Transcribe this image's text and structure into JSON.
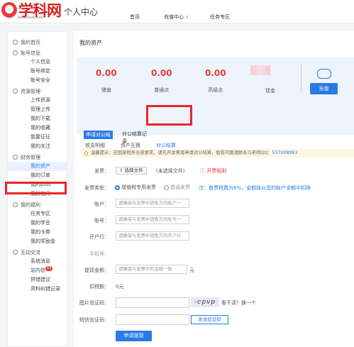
{
  "header": {
    "logo_text": "学科网",
    "logo_sub": "www.zxxk.com",
    "page_heading": "个人中心",
    "nav": [
      "首页",
      "充值中心",
      "任务专区"
    ],
    "nav_caret": "∨"
  },
  "sidebar": {
    "home": "我的首页",
    "groups": [
      {
        "title": "账号信息",
        "icon": "star-icon",
        "items": [
          "个人信息",
          "账号绑定",
          "账号安全"
        ]
      },
      {
        "title": "资源管理",
        "icon": "folder-icon",
        "items": [
          "上传资源",
          "管理上传",
          "我的下载",
          "我的收藏",
          "我要征征",
          "我的关注"
        ]
      },
      {
        "title": "财务管理",
        "icon": "wallet-icon",
        "items": [
          "我的资产",
          "我的订单",
          "我的plus",
          "我的包月"
        ]
      },
      {
        "title": "我的福利",
        "icon": "gift-icon",
        "items": [
          "任务专区",
          "我的学豆",
          "我的卡券",
          "我的奖励金"
        ]
      },
      {
        "title": "互动交流",
        "icon": "chat-icon",
        "items": [
          "系统消息",
          "站内信",
          "拼错建议",
          "资料纠错记录"
        ]
      }
    ],
    "messages_badge": "02",
    "active_item": "我的资产"
  },
  "main": {
    "title": "我的资产",
    "assets": [
      {
        "value": "0.00",
        "label": "储值"
      },
      {
        "value": "0.00",
        "label": "普通点"
      },
      {
        "value": "0.00",
        "label": "高级点"
      },
      {
        "value": "",
        "label": "现金"
      }
    ],
    "recharge_label": "充值",
    "tabs": [
      "收支明细",
      "资产互换",
      "对公结算"
    ],
    "active_tab": "对公结算",
    "subtabs": [
      "申请对公结",
      "对公结算记录"
    ],
    "notice": {
      "prefix": "温馨提示：",
      "text": "应国家税务合规要求，请先开发票再申请对公结算，如有问题请联系马老师QQ：",
      "qq": "537008993"
    },
    "form": {
      "invoice_label": "发票：",
      "choose_file": "⇧ 选择文件",
      "no_file": "(未选择文件)",
      "rules_link": "ⓘ 开票规则",
      "invoice_type_label": "发票类型：",
      "type_special": "增值税专用发票",
      "type_normal": "普通发票",
      "note_prefix": "注：",
      "note": "普票税费为6%，金额抹从您的账户余额中扣除",
      "account_label": "账户：",
      "account_placeholder": "请确保与发票中销售方的账户一",
      "number_label": "账号：",
      "number_placeholder": "请确保与发票中销售方的账号一",
      "bank_label": "开户行：",
      "bank_placeholder": "请确保与发票中销售方的开户行",
      "phone_label": "手机号：",
      "amount_label": "提现金额：",
      "amount_placeholder": "请确保与发票中的金额一致",
      "amount_unit": "元",
      "tax_label": "扣税额：",
      "tax_value": "0元",
      "captcha_label": "图片验证码：",
      "captcha_text": "-cpvp",
      "captcha_hint": "看不清？换一个",
      "sms_label": "短信验证码：",
      "sms_button": "发送验证码",
      "submit": "申请提现"
    }
  }
}
